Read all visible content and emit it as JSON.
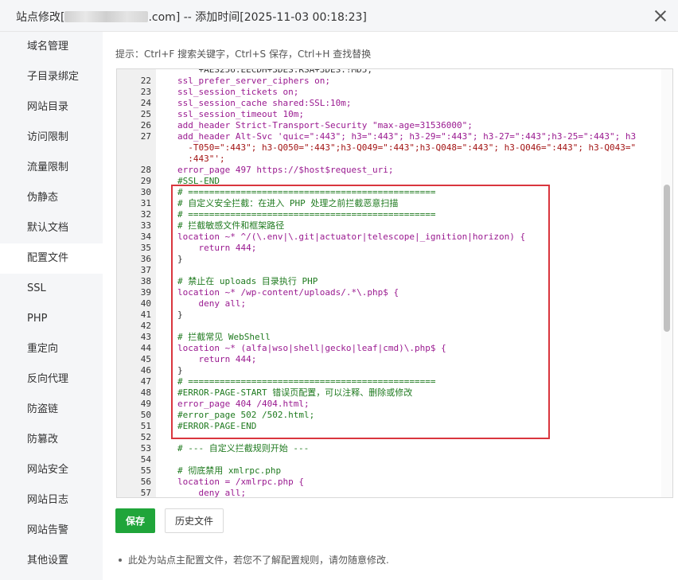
{
  "titlebar": {
    "title_prefix": "站点修改[",
    "title_suffix": ".com] -- 添加时间[2025-11-03 00:18:23]"
  },
  "sidebar": {
    "items": [
      {
        "label": "域名管理"
      },
      {
        "label": "子目录绑定"
      },
      {
        "label": "网站目录"
      },
      {
        "label": "访问限制"
      },
      {
        "label": "流量限制"
      },
      {
        "label": "伪静态"
      },
      {
        "label": "默认文档"
      },
      {
        "label": "配置文件"
      },
      {
        "label": "SSL"
      },
      {
        "label": "PHP"
      },
      {
        "label": "重定向"
      },
      {
        "label": "反向代理"
      },
      {
        "label": "防盗链"
      },
      {
        "label": "防篡改"
      },
      {
        "label": "网站安全"
      },
      {
        "label": "网站日志"
      },
      {
        "label": "网站告警"
      },
      {
        "label": "其他设置"
      }
    ],
    "active_index": 7
  },
  "main": {
    "hint": "提示：Ctrl+F 搜索关键字，Ctrl+S 保存，Ctrl+H 查找替换",
    "save_label": "保存",
    "history_label": "历史文件",
    "note": "此处为站点主配置文件，若您不了解配置规则，请勿随意修改."
  },
  "editor": {
    "lines": [
      {
        "num": "",
        "text": "    +AES256:EECDH+3DES:RSA+3DES:!MD5;",
        "cls": "c-plain",
        "cont": true
      },
      {
        "num": "22",
        "text": "ssl_prefer_server_ciphers on;",
        "cls": "c-kw"
      },
      {
        "num": "23",
        "text": "ssl_session_tickets on;",
        "cls": "c-kw"
      },
      {
        "num": "24",
        "text": "ssl_session_cache shared:SSL:10m;",
        "cls": "c-kw"
      },
      {
        "num": "25",
        "text": "ssl_session_timeout 10m;",
        "cls": "c-kw"
      },
      {
        "num": "26",
        "text": "add_header Strict-Transport-Security \"max-age=31536000\";",
        "cls": "c-kw"
      },
      {
        "num": "27",
        "text": "add_header Alt-Svc 'quic=\":443\"; h3=\":443\"; h3-29=\":443\"; h3-27=\":443\";h3-25=\":443\"; h3",
        "cls": "c-kw"
      },
      {
        "num": "",
        "text": "  -T050=\":443\"; h3-Q050=\":443\";h3-Q049=\":443\";h3-Q048=\":443\"; h3-Q046=\":443\"; h3-Q043=\"",
        "cls": "c-str",
        "cont": true
      },
      {
        "num": "",
        "text": "  :443\"';",
        "cls": "c-str",
        "cont": true
      },
      {
        "num": "28",
        "text": "error_page 497 https://$host$request_uri;",
        "cls": "c-kw"
      },
      {
        "num": "29",
        "text": "#SSL-END",
        "cls": "c-comment"
      },
      {
        "num": "30",
        "text": "# ===============================================",
        "cls": "c-comment"
      },
      {
        "num": "31",
        "text": "# 自定义安全拦截：在进入 PHP 处理之前拦截恶意扫描",
        "cls": "c-comment"
      },
      {
        "num": "32",
        "text": "# ===============================================",
        "cls": "c-comment"
      },
      {
        "num": "33",
        "text": "# 拦截敏感文件和框架路径",
        "cls": "c-comment"
      },
      {
        "num": "34",
        "text": "location ~* ^/(\\.env|\\.git|actuator|telescope|_ignition|horizon) {",
        "cls": "c-kw"
      },
      {
        "num": "35",
        "text": "    return 444;",
        "cls": "c-kw"
      },
      {
        "num": "36",
        "text": "}",
        "cls": "c-plain"
      },
      {
        "num": "37",
        "text": "",
        "cls": "c-plain"
      },
      {
        "num": "38",
        "text": "# 禁止在 uploads 目录执行 PHP",
        "cls": "c-comment"
      },
      {
        "num": "39",
        "text": "location ~* /wp-content/uploads/.*\\.php$ {",
        "cls": "c-kw"
      },
      {
        "num": "40",
        "text": "    deny all;",
        "cls": "c-kw"
      },
      {
        "num": "41",
        "text": "}",
        "cls": "c-plain"
      },
      {
        "num": "42",
        "text": "",
        "cls": "c-plain"
      },
      {
        "num": "43",
        "text": "# 拦截常见 WebShell",
        "cls": "c-comment"
      },
      {
        "num": "44",
        "text": "location ~* (alfa|wso|shell|gecko|leaf|cmd)\\.php$ {",
        "cls": "c-kw"
      },
      {
        "num": "45",
        "text": "    return 444;",
        "cls": "c-kw"
      },
      {
        "num": "46",
        "text": "}",
        "cls": "c-plain"
      },
      {
        "num": "47",
        "text": "# ===============================================",
        "cls": "c-comment"
      },
      {
        "num": "48",
        "text": "#ERROR-PAGE-START 错误页配置，可以注释、删除或修改",
        "cls": "c-comment"
      },
      {
        "num": "49",
        "text": "error_page 404 /404.html;",
        "cls": "c-kw"
      },
      {
        "num": "50",
        "text": "#error_page 502 /502.html;",
        "cls": "c-comment"
      },
      {
        "num": "51",
        "text": "#ERROR-PAGE-END",
        "cls": "c-comment"
      },
      {
        "num": "52",
        "text": "",
        "cls": "c-plain"
      },
      {
        "num": "53",
        "text": "# --- 自定义拦截规则开始 ---",
        "cls": "c-comment"
      },
      {
        "num": "54",
        "text": "",
        "cls": "c-plain"
      },
      {
        "num": "55",
        "text": "# 彻底禁用 xmlrpc.php",
        "cls": "c-comment"
      },
      {
        "num": "56",
        "text": "location = /xmlrpc.php {",
        "cls": "c-kw"
      },
      {
        "num": "57",
        "text": "    deny all;",
        "cls": "c-kw"
      }
    ]
  },
  "colors": {
    "accent_green": "#20a53a",
    "highlight_red": "#d9363e"
  }
}
